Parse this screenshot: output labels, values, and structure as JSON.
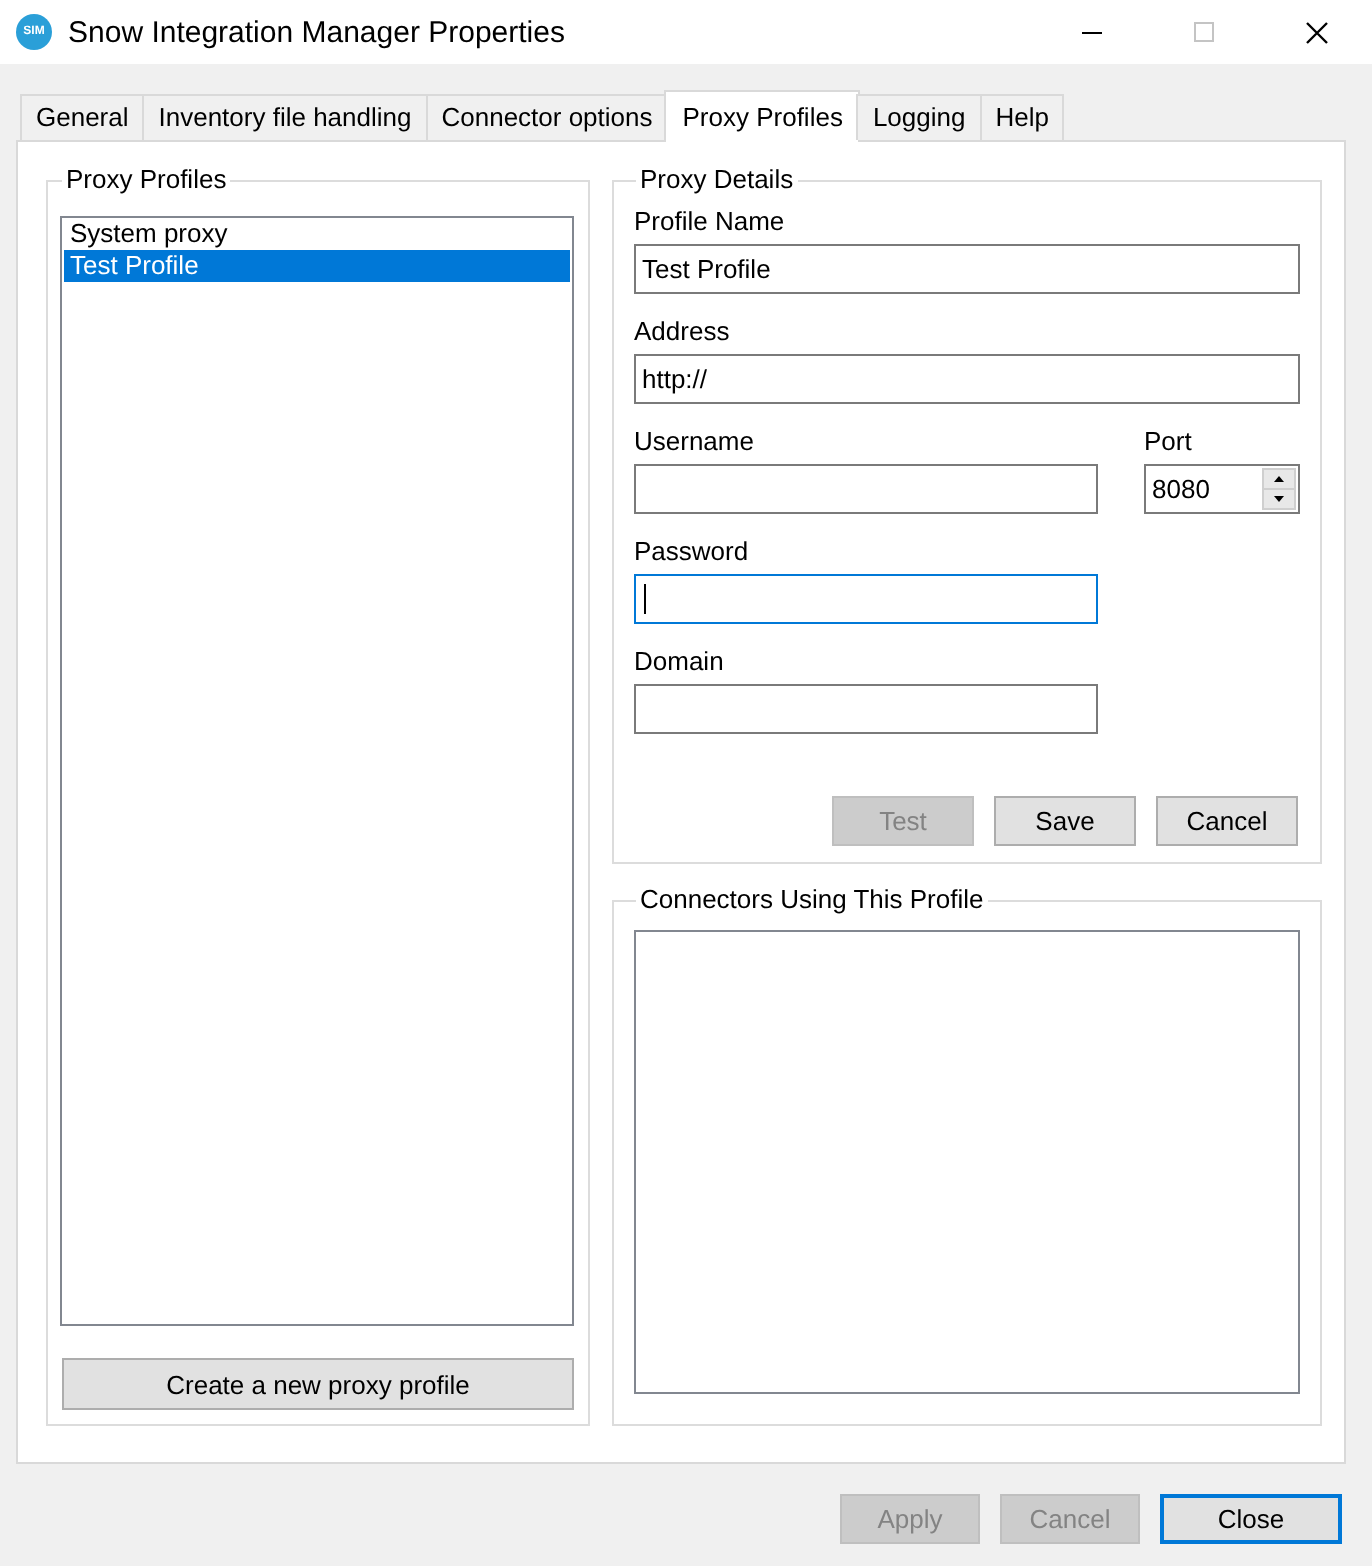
{
  "window": {
    "logo": "SIM",
    "title": "Snow Integration Manager Properties",
    "controls": [
      {
        "kind": "minimize",
        "disabled": false
      },
      {
        "kind": "maximize",
        "disabled": true
      },
      {
        "kind": "close",
        "disabled": false
      }
    ]
  },
  "tabs": [
    {
      "label": "General",
      "selected": false
    },
    {
      "label": "Inventory file handling",
      "selected": false
    },
    {
      "label": "Connector options",
      "selected": false
    },
    {
      "label": "Proxy Profiles",
      "selected": true
    },
    {
      "label": "Logging",
      "selected": false
    },
    {
      "label": "Help",
      "selected": false
    }
  ],
  "proxy_profiles": {
    "title": "Proxy Profiles",
    "items": [
      {
        "label": "System proxy",
        "selected": false
      },
      {
        "label": "Test Profile",
        "selected": true
      }
    ],
    "create_button": "Create a new proxy profile"
  },
  "proxy_details": {
    "title": "Proxy Details",
    "fields": [
      {
        "label": "Profile Name",
        "kind": "wide",
        "value": "Test Profile",
        "focused": false
      },
      {
        "label": "Address",
        "kind": "wide",
        "value": "http://",
        "focused": false
      },
      {
        "label": "Username",
        "kind": "text",
        "focused": false
      },
      {
        "label": "Port",
        "kind": "spinner",
        "value": "8080",
        "focused": false
      },
      {
        "label": "Password",
        "kind": "text",
        "focused": true
      },
      {
        "label": "Domain",
        "kind": "text",
        "focused": false
      }
    ],
    "buttons": [
      {
        "label": "Test",
        "disabled": true
      },
      {
        "label": "Save",
        "disabled": false
      },
      {
        "label": "Cancel",
        "disabled": false
      }
    ]
  },
  "connectors": {
    "title": "Connectors Using This Profile"
  },
  "footer_buttons": [
    {
      "label": "Apply",
      "disabled": true,
      "default": false
    },
    {
      "label": "Cancel",
      "disabled": true,
      "default": false
    },
    {
      "label": "Close",
      "disabled": false,
      "default": true
    }
  ]
}
